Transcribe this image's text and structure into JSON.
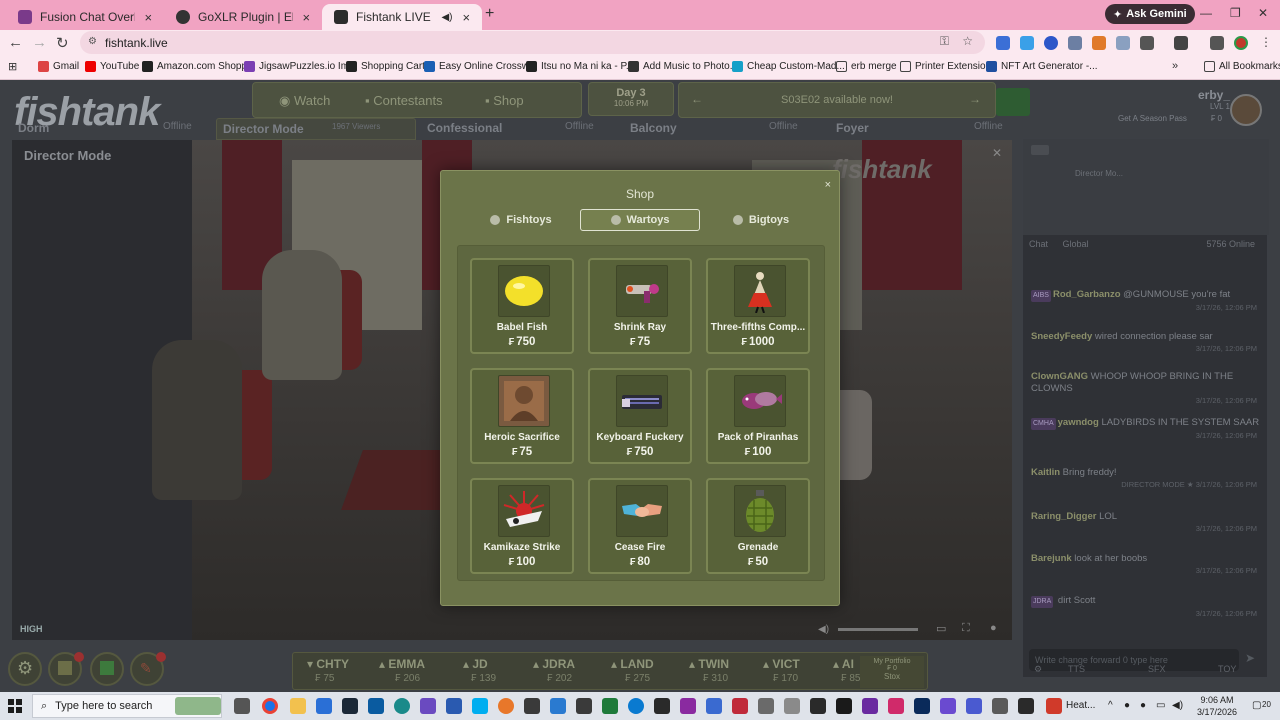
{
  "browser": {
    "tabs": [
      {
        "title": "Fusion Chat Overlay",
        "active": false,
        "icon": "fusion-favicon"
      },
      {
        "title": "GoXLR Plugin | Elgato Marketp...",
        "active": false,
        "icon": "elgato-favicon"
      },
      {
        "title": "Fishtank LIVE",
        "active": true,
        "icon": "fishtank-favicon"
      }
    ],
    "new_tab": "+",
    "ask_gemini": "Ask Gemini",
    "url": "fishtank.live",
    "bookmarks": [
      "Gmail",
      "YouTube",
      "Amazon.com Shopp...",
      "JigsawPuzzles.io Im...",
      "Shopping Cart",
      "Easy Online Crossw...",
      "Itsu no Ma ni ka - P...",
      "Add Music to Photo...",
      "Cheap Custom-Mad...",
      "erb merge",
      "Printer Extension",
      "NFT Art Generator -..."
    ],
    "all_bookmarks": "All Bookmarks"
  },
  "site": {
    "logo": "fishtank",
    "nav": [
      "Watch",
      "Contestants",
      "Shop"
    ],
    "day": {
      "label": "Day 3",
      "time": "10:06 PM"
    },
    "announcement": "S03E02 available now!",
    "user": {
      "name": "erby_",
      "level": "LVL 1",
      "balance": "₣ 0",
      "season_pass": "Get A Season Pass"
    }
  },
  "camera_tabs": [
    {
      "name": "Dorm",
      "status": "Offline"
    },
    {
      "name": "Director Mode",
      "status": "1967 Viewers"
    },
    {
      "name": "Confessional",
      "status": "Offline"
    },
    {
      "name": "Balcony",
      "status": "Offline"
    },
    {
      "name": "Foyer",
      "status": "Offline"
    }
  ],
  "video": {
    "title": "Director Mode",
    "watermark": "fishtank",
    "quality": "HIGH"
  },
  "shop": {
    "title": "Shop",
    "close": "×",
    "tabs": [
      "Fishtoys",
      "Wartoys",
      "Bigtoys"
    ],
    "selected_tab": "Wartoys",
    "currency": "₣",
    "items": [
      {
        "name": "Babel Fish",
        "price": "750",
        "icon": "lemon-icon"
      },
      {
        "name": "Shrink Ray",
        "price": "75",
        "icon": "ray-gun-icon"
      },
      {
        "name": "Three-fifths Comp...",
        "price": "1000",
        "icon": "ballerina-icon"
      },
      {
        "name": "Heroic Sacrifice",
        "price": "75",
        "icon": "bust-icon"
      },
      {
        "name": "Keyboard Fuckery",
        "price": "750",
        "icon": "keyboard-icon"
      },
      {
        "name": "Pack of Piranhas",
        "price": "100",
        "icon": "piranha-icon"
      },
      {
        "name": "Kamikaze Strike",
        "price": "100",
        "icon": "plane-icon"
      },
      {
        "name": "Cease Fire",
        "price": "80",
        "icon": "handshake-icon"
      },
      {
        "name": "Grenade",
        "price": "50",
        "icon": "grenade-icon"
      }
    ]
  },
  "chat": {
    "header": "Director Mo...",
    "tabs": [
      "Chat",
      "Global"
    ],
    "online": "5756 Online",
    "messages": [
      {
        "user": "Rod_Garbanzo",
        "badge": "AIBS",
        "text": "@GUNMOUSE you're fat",
        "ts": "3/17/26, 12:06 PM"
      },
      {
        "user": "SneedyFeedy",
        "badge": "",
        "text": "wired connection please sar",
        "ts": "3/17/26, 12:06 PM"
      },
      {
        "user": "ClownGANG",
        "badge": "",
        "text": "WHOOP WHOOP BRING IN THE CLOWNS",
        "ts": "3/17/26, 12:06 PM"
      },
      {
        "user": "yawndog",
        "badge": "CMHA",
        "text": "LADYBIRDS IN THE SYSTEM SAAR",
        "ts": "3/17/26, 12:06 PM"
      },
      {
        "user": "Kaitlin",
        "badge": "",
        "text": "Bring freddy!",
        "ts": "DIRECTOR MODE ★ 3/17/26, 12:06 PM"
      },
      {
        "user": "Raring_Digger",
        "badge": "",
        "text": "LOL",
        "ts": "3/17/26, 12:06 PM"
      },
      {
        "user": "Barejunk",
        "badge": "",
        "text": "look at her boobs",
        "ts": "3/17/26, 12:06 PM"
      },
      {
        "user": "",
        "badge": "JDRA",
        "text": "dirt Scott",
        "ts": "3/17/26, 12:06 PM"
      }
    ],
    "input_placeholder": "Write change forward 0 type here",
    "footer": {
      "tts": "TTS",
      "sfx": "SFX",
      "toy": "TOY"
    }
  },
  "ticker": [
    {
      "sym": "CHTY",
      "val": "₣ 75"
    },
    {
      "sym": "EMMA",
      "val": "₣ 206"
    },
    {
      "sym": "JD",
      "val": "₣ 139"
    },
    {
      "sym": "JDRA",
      "val": "₣ 202"
    },
    {
      "sym": "LAND",
      "val": "₣ 275"
    },
    {
      "sym": "TWIN",
      "val": "₣ 310"
    },
    {
      "sym": "VICT",
      "val": "₣ 170"
    },
    {
      "sym": "AI",
      "val": "₣ 85"
    }
  ],
  "portfolio": {
    "label": "My Portfolio",
    "value": "₣ 0",
    "stox": "Stox"
  },
  "taskbar": {
    "search": "Type here to search",
    "weather": "Heat...",
    "time": "9:06 AM",
    "date": "3/17/2026",
    "notifications": "20"
  },
  "colors": {
    "tabstrip": "#f1a3c2",
    "shop_bg": "#6b7449",
    "card_bg": "#586239"
  }
}
